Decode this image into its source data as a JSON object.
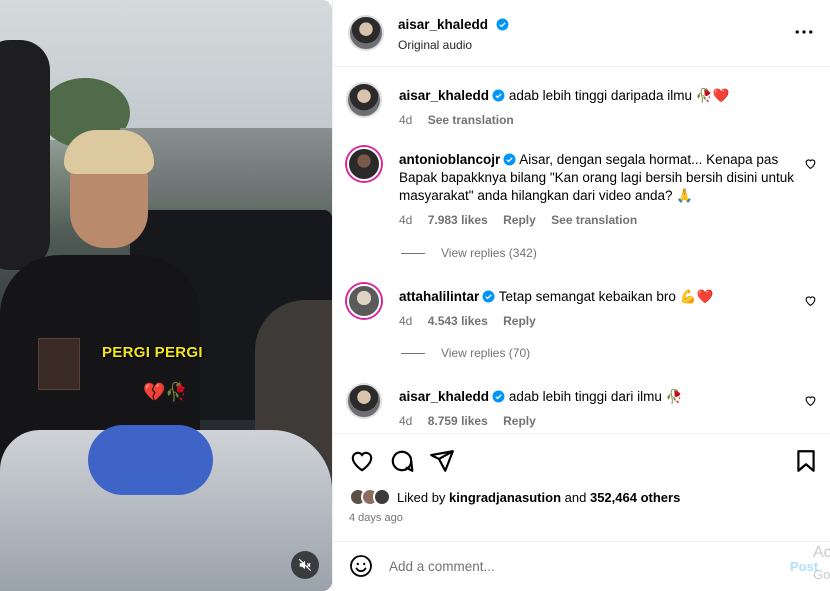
{
  "video": {
    "caption": "PERGI PERGI",
    "emoji": "💔🥀",
    "mute_icon": "speaker-muted-icon"
  },
  "header": {
    "username": "aisar_khaledd",
    "subtitle": "Original audio",
    "more_icon": "more-horizontal-icon"
  },
  "comments": [
    {
      "username": "aisar_khaledd",
      "text": "adab lebih tinggi daripada ilmu 🥀❤️",
      "time": "4d",
      "likes": "",
      "reply": "",
      "translation": "See translation"
    },
    {
      "username": "antonioblancojr",
      "text": "Aisar, dengan segala hormat... Kenapa pas Bapak bapakknya bilang \"Kan orang lagi bersih bersih disini untuk masyarakat\" anda hilangkan dari video anda? 🙏",
      "time": "4d",
      "likes": "7.983 likes",
      "reply": "Reply",
      "translation": "See translation",
      "view_replies": "View replies (342)"
    },
    {
      "username": "attahalilintar",
      "text": "Tetap semangat kebaikan bro 💪❤️",
      "time": "4d",
      "likes": "4.543 likes",
      "reply": "Reply",
      "translation": "",
      "view_replies": "View replies (70)"
    },
    {
      "username": "aisar_khaledd",
      "text": "adab lebih tinggi dari ilmu 🥀",
      "time": "4d",
      "likes": "8.759 likes",
      "reply": "Reply",
      "translation": ""
    }
  ],
  "actions": {
    "like_icon": "heart-icon",
    "comment_icon": "comment-icon",
    "share_icon": "share-icon",
    "save_icon": "bookmark-icon"
  },
  "likes": {
    "prefix": "Liked by",
    "user": "kingradjanasution",
    "and": "and",
    "count": "352,464 others"
  },
  "posted_ago": "4 days ago",
  "add_comment": {
    "placeholder": "Add a comment...",
    "post_label": "Post"
  },
  "edge_ghost": [
    "Ac",
    "Go"
  ],
  "colors": {
    "verified": "#0095f6",
    "story_ring": "#d6249f",
    "post_disabled": "#b2dffc",
    "muted_text": "#737373"
  }
}
